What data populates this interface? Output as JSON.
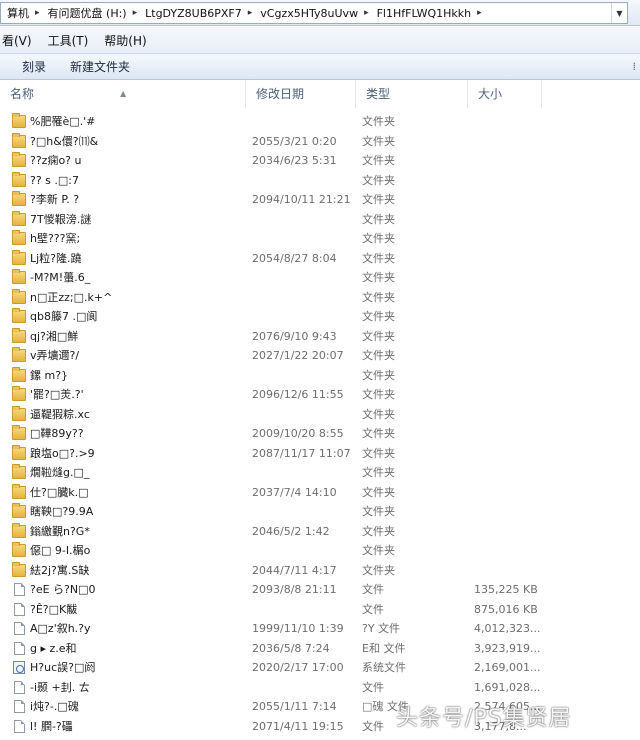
{
  "address": {
    "crumbs": [
      "算机",
      "有问题优盘 (H:)",
      "LtgDYZ8UB6PXF7",
      "vCgzx5HTy8uUvw",
      "Fl1HfFLWQ1Hkkh"
    ]
  },
  "menu": [
    "看(V)",
    "工具(T)",
    "帮助(H)"
  ],
  "toolbar": {
    "burn": "刻录",
    "new_folder": "新建文件夹"
  },
  "columns": {
    "name": "名称",
    "date": "修改日期",
    "type": "类型",
    "size": "大小"
  },
  "rows": [
    {
      "kind": "folder",
      "name": "%肥罹è□.'#",
      "date": "",
      "type": "文件夹",
      "size": ""
    },
    {
      "kind": "folder",
      "name": "?□h&儇?⑾&",
      "date": "2055/3/21 0:20",
      "type": "文件夹",
      "size": ""
    },
    {
      "kind": "folder",
      "name": "??z痫o? u",
      "date": "2034/6/23 5:31",
      "type": "文件夹",
      "size": ""
    },
    {
      "kind": "folder",
      "name": "??   s .□:7",
      "date": "",
      "type": "文件夹",
      "size": ""
    },
    {
      "kind": "folder",
      "name": "?李新 P. ?",
      "date": "2094/10/11 21:21",
      "type": "文件夹",
      "size": ""
    },
    {
      "kind": "folder",
      "name": "7T惾鞎滂.謎",
      "date": "",
      "type": "文件夹",
      "size": ""
    },
    {
      "kind": "folder",
      "name": "h壁???窯;",
      "date": "",
      "type": "文件夹",
      "size": ""
    },
    {
      "kind": "folder",
      "name": "Lj粒?隆.蹺",
      "date": "2054/8/27 8:04",
      "type": "文件夹",
      "size": ""
    },
    {
      "kind": "folder",
      "name": "-M?M!蠆.6_",
      "date": "",
      "type": "文件夹",
      "size": ""
    },
    {
      "kind": "folder",
      "name": "n□正zz;□.k+^",
      "date": "",
      "type": "文件夹",
      "size": ""
    },
    {
      "kind": "folder",
      "name": "qb8籐7   .□阆",
      "date": "",
      "type": "文件夹",
      "size": ""
    },
    {
      "kind": "folder",
      "name": "qj?湘□鮮",
      "date": "2076/9/10 9:43",
      "type": "文件夹",
      "size": ""
    },
    {
      "kind": "folder",
      "name": "v弄壙邇?/",
      "date": "2027/1/22 20:07",
      "type": "文件夹",
      "size": ""
    },
    {
      "kind": "folder",
      "name": "    鏍    m?}",
      "date": "",
      "type": "文件夹",
      "size": ""
    },
    {
      "kind": "folder",
      "name": "'罷?□羙.?'",
      "date": "2096/12/6 11:55",
      "type": "文件夹",
      "size": ""
    },
    {
      "kind": "folder",
      "name": "逼鞮猳粽.xc",
      "date": "",
      "type": "文件夹",
      "size": ""
    },
    {
      "kind": "folder",
      "name": "□鞾89y??",
      "date": "2009/10/20 8:55",
      "type": "文件夹",
      "size": ""
    },
    {
      "kind": "folder",
      "name": "踉塩o□?.>9",
      "date": "2087/11/17 11:07",
      "type": "文件夹",
      "size": ""
    },
    {
      "kind": "folder",
      "name": "燗鞡熢g.□_",
      "date": "",
      "type": "文件夹",
      "size": ""
    },
    {
      "kind": "folder",
      "name": "仕?□臓k.□",
      "date": "2037/7/4 14:10",
      "type": "文件夹",
      "size": ""
    },
    {
      "kind": "folder",
      "name": "瞎鞅□?9.9A",
      "date": "",
      "type": "文件夹",
      "size": ""
    },
    {
      "kind": "folder",
      "name": "鎓繳覲n?G*",
      "date": "2046/5/2 1:42",
      "type": "文件夹",
      "size": ""
    },
    {
      "kind": "folder",
      "name": "僫□  9-I.榍o",
      "date": "",
      "type": "文件夹",
      "size": ""
    },
    {
      "kind": "folder",
      "name": "紶2j?寓.S缺",
      "date": "2044/7/11 4:17",
      "type": "文件夹",
      "size": ""
    },
    {
      "kind": "file",
      "name": "?eE ら?N□0",
      "date": "2093/8/8 21:11",
      "type": "文件",
      "size": "135,225 KB"
    },
    {
      "kind": "file",
      "name": "?Ê?□K黻",
      "date": "",
      "type": "文件",
      "size": "875,016 KB"
    },
    {
      "kind": "file",
      "name": "A□z'叙h.?y",
      "date": "1999/11/10 1:39",
      "type": "?Y 文件",
      "size": "4,012,323..."
    },
    {
      "kind": "file",
      "name": "g   ▸     z.e和",
      "date": "2036/5/8 7:24",
      "type": "E和 文件",
      "size": "3,923,919..."
    },
    {
      "kind": "sysfile",
      "name": "H?uc誤?□阏",
      "date": "2020/2/17 17:00",
      "type": "系统文件",
      "size": "2,169,001..."
    },
    {
      "kind": "file",
      "name": "-i颞 +刲. ㄊ",
      "date": "",
      "type": "文件",
      "size": "1,691,028..."
    },
    {
      "kind": "file",
      "name": "i炖?-.□磈",
      "date": "2055/1/11 7:14",
      "type": "□磈 文件",
      "size": "2,574,605..."
    },
    {
      "kind": "file",
      "name": "l!   膶-?礧",
      "date": "2071/4/11 19:15",
      "type": "文件",
      "size": "3,177,8..."
    }
  ],
  "watermark": "头条号/PS集贤居"
}
